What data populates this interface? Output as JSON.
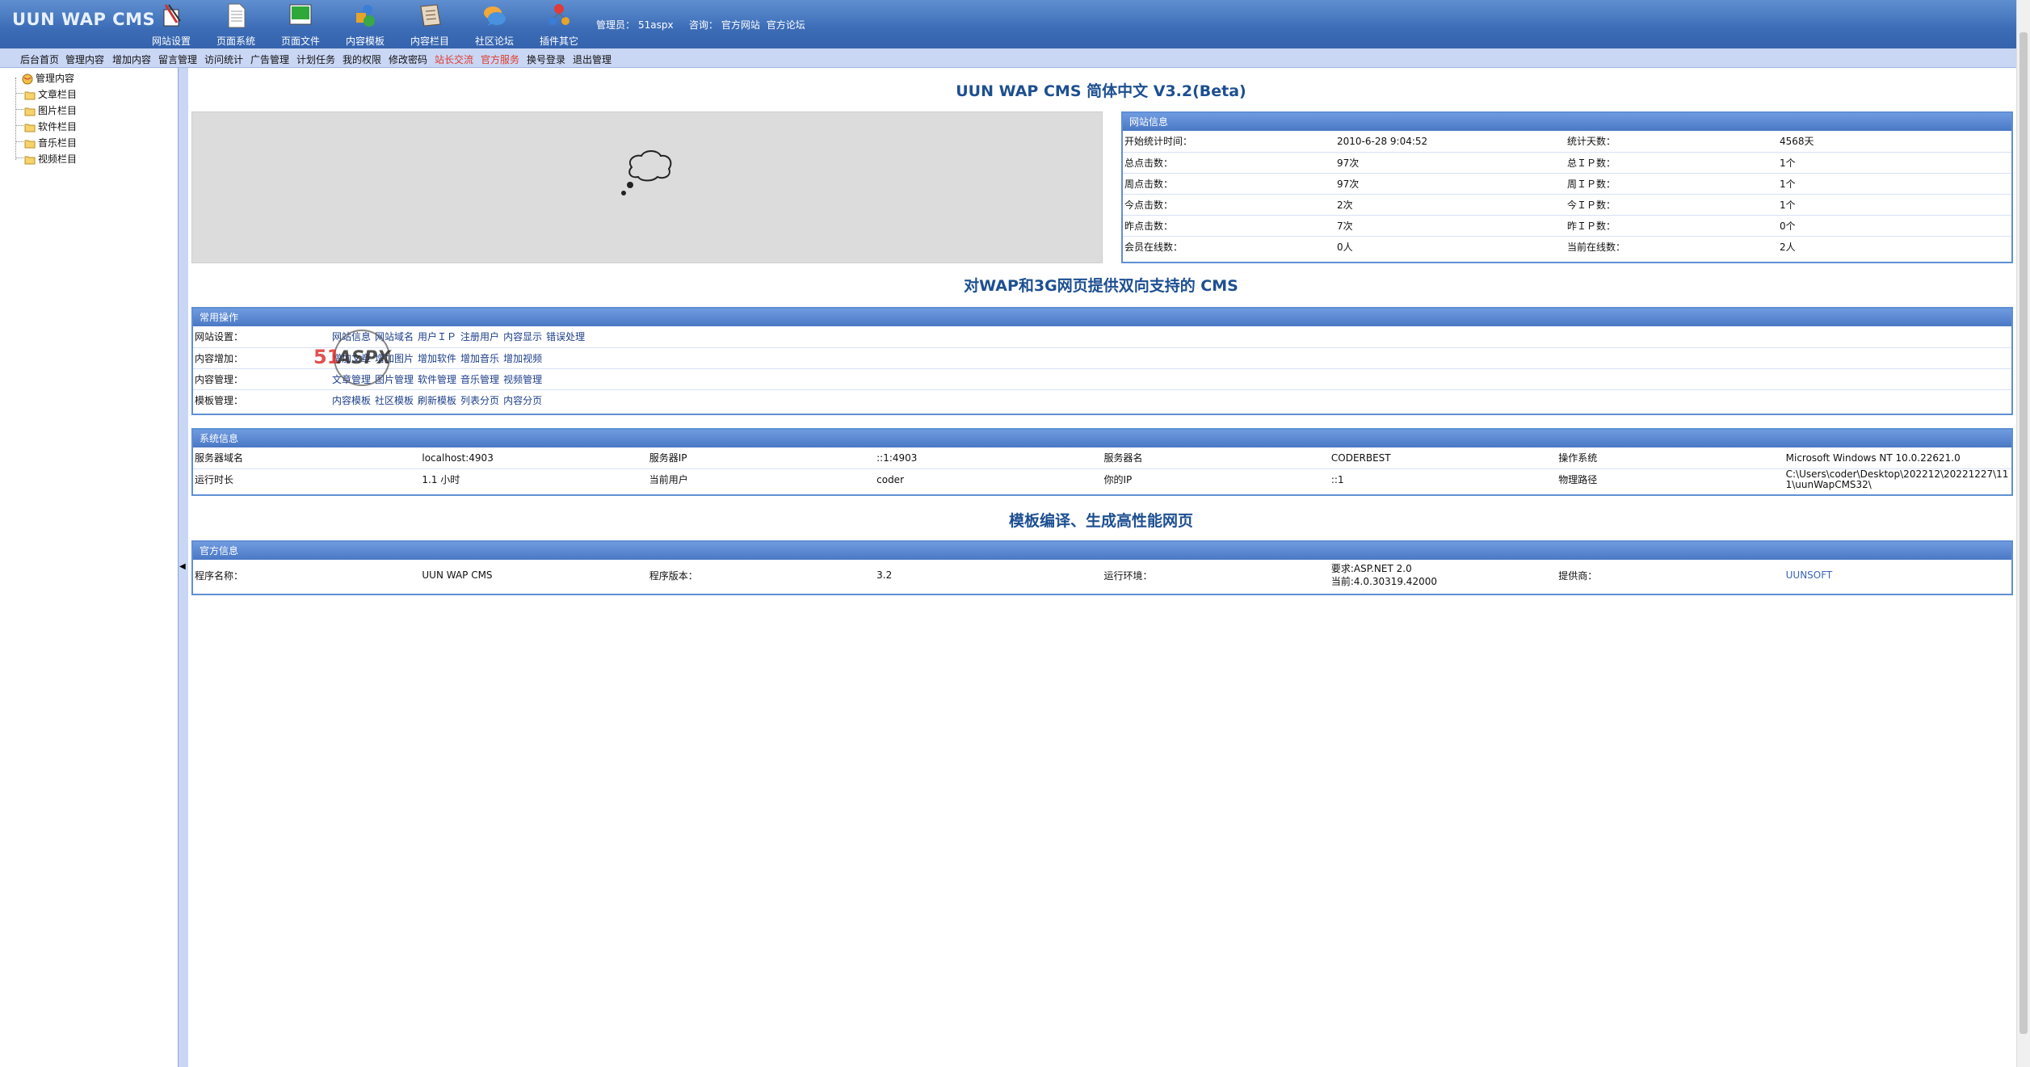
{
  "app": {
    "logo": "UUN WAP CMS"
  },
  "topnav": [
    {
      "label": "网站设置",
      "icon": "settings-icon"
    },
    {
      "label": "页面系统",
      "icon": "page-icon"
    },
    {
      "label": "页面文件",
      "icon": "file-icon"
    },
    {
      "label": "内容模板",
      "icon": "template-icon"
    },
    {
      "label": "内容栏目",
      "icon": "column-icon"
    },
    {
      "label": "社区论坛",
      "icon": "forum-icon"
    },
    {
      "label": "插件其它",
      "icon": "plugin-icon"
    }
  ],
  "admin": {
    "label": "管理员：",
    "name": "51aspx",
    "consult_label": "咨询：",
    "link1": "官方网站",
    "link2": "官方论坛"
  },
  "menu": [
    "后台首页",
    "管理内容",
    "增加内容",
    "留言管理",
    "访问统计",
    "广告管理",
    "计划任务",
    "我的权限",
    "修改密码",
    "站长交流",
    "官方服务",
    "换号登录",
    "退出管理"
  ],
  "tree": {
    "root": "管理内容",
    "children": [
      "文章栏目",
      "图片栏目",
      "软件栏目",
      "音乐栏目",
      "视频栏目"
    ]
  },
  "main": {
    "title": "UUN WAP CMS 简体中文 V3.2(Beta)",
    "subtitle1": "对WAP和3G网页提供双向支持的 CMS",
    "subtitle2": "模板编译、生成高性能网页"
  },
  "site_info": {
    "header": "网站信息",
    "rows": [
      [
        "开始统计时间：",
        "2010-6-28 9:04:52",
        "统计天数：",
        "4568天"
      ],
      [
        "总点击数：",
        "97次",
        "总ＩＰ数：",
        "1个"
      ],
      [
        "周点击数：",
        "97次",
        "周ＩＰ数：",
        "1个"
      ],
      [
        "今点击数：",
        "2次",
        "今ＩＰ数：",
        "1个"
      ],
      [
        "昨点击数：",
        "7次",
        "昨ＩＰ数：",
        "0个"
      ],
      [
        "会员在线数：",
        "0人",
        "当前在线数：",
        "2人"
      ]
    ]
  },
  "common_ops": {
    "header": "常用操作",
    "rows": [
      {
        "label": "网站设置：",
        "links": [
          "网站信息",
          "网站域名",
          "用户ＩＰ",
          "注册用户",
          "内容显示",
          "错误处理"
        ]
      },
      {
        "label": "内容增加：",
        "links": [
          "增加文章",
          "增加图片",
          "增加软件",
          "增加音乐",
          "增加视频"
        ]
      },
      {
        "label": "内容管理：",
        "links": [
          "文章管理",
          "图片管理",
          "软件管理",
          "音乐管理",
          "视频管理"
        ]
      },
      {
        "label": "模板管理：",
        "links": [
          "内容模板",
          "社区模板",
          "刷新模板",
          "列表分页",
          "内容分页"
        ]
      }
    ]
  },
  "system_info": {
    "header": "系统信息",
    "rows": [
      [
        "服务器域名",
        "localhost:4903",
        "服务器IP",
        "::1:4903",
        "服务器名",
        "CODERBEST",
        "操作系统",
        "Microsoft Windows NT 10.0.22621.0"
      ],
      [
        "运行时长",
        "1.1 小时",
        "当前用户",
        "coder",
        "你的IP",
        "::1",
        "物理路径",
        "C:\\Users\\coder\\Desktop\\202212\\20221227\\111\\uunWapCMS32\\"
      ]
    ]
  },
  "official_info": {
    "header": "官方信息",
    "name_label": "程序名称：",
    "name": "UUN WAP CMS",
    "version_label": "程序版本：",
    "version": "3.2",
    "env_label": "运行环境：",
    "env_req": "要求:ASP.NET 2.0",
    "env_cur": "当前:4.0.30319.42000",
    "provider_label": "提供商：",
    "provider": "UUNSOFT"
  },
  "watermark": {
    "text": "51aspx"
  }
}
